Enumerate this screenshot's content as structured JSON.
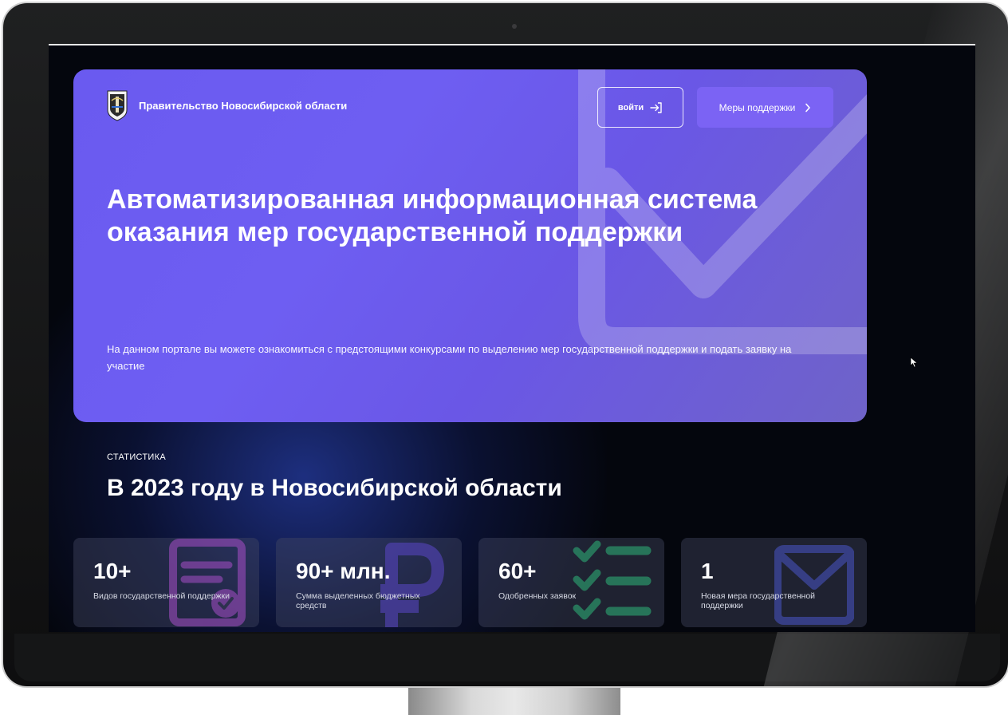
{
  "header": {
    "org_name": "Правительство Новосибирской области",
    "login_label": "войти",
    "measures_label": "Меры поддержки"
  },
  "hero": {
    "title": "Автоматизированная информационная система оказания мер государственной поддержки",
    "description": "На данном портале вы можете ознакомиться с предстоящими конкурсами по выделению мер государственной поддержки и подать заявку на участие"
  },
  "stats": {
    "section_label": "СТАТИСТИКА",
    "title": "В 2023 году в Новосибирской области",
    "cards": [
      {
        "value": "10+",
        "text": "Видов государственной поддержки",
        "icon": "document-check-icon",
        "icon_color": "#a84fc8"
      },
      {
        "value": "90+ млн.",
        "text": "Сумма выделенных бюджетных средств",
        "icon": "ruble-icon",
        "icon_color": "#5b47c8"
      },
      {
        "value": "60+",
        "text": "Одобренных заявок",
        "icon": "checklist-icon",
        "icon_color": "#2fb87a"
      },
      {
        "value": "1",
        "text": "Новая мера государственной поддержки",
        "icon": "envelope-icon",
        "icon_color": "#4a56c8"
      }
    ]
  },
  "colors": {
    "accent": "#6e5ef2",
    "button": "#7b63f4",
    "background": "#04060d"
  }
}
